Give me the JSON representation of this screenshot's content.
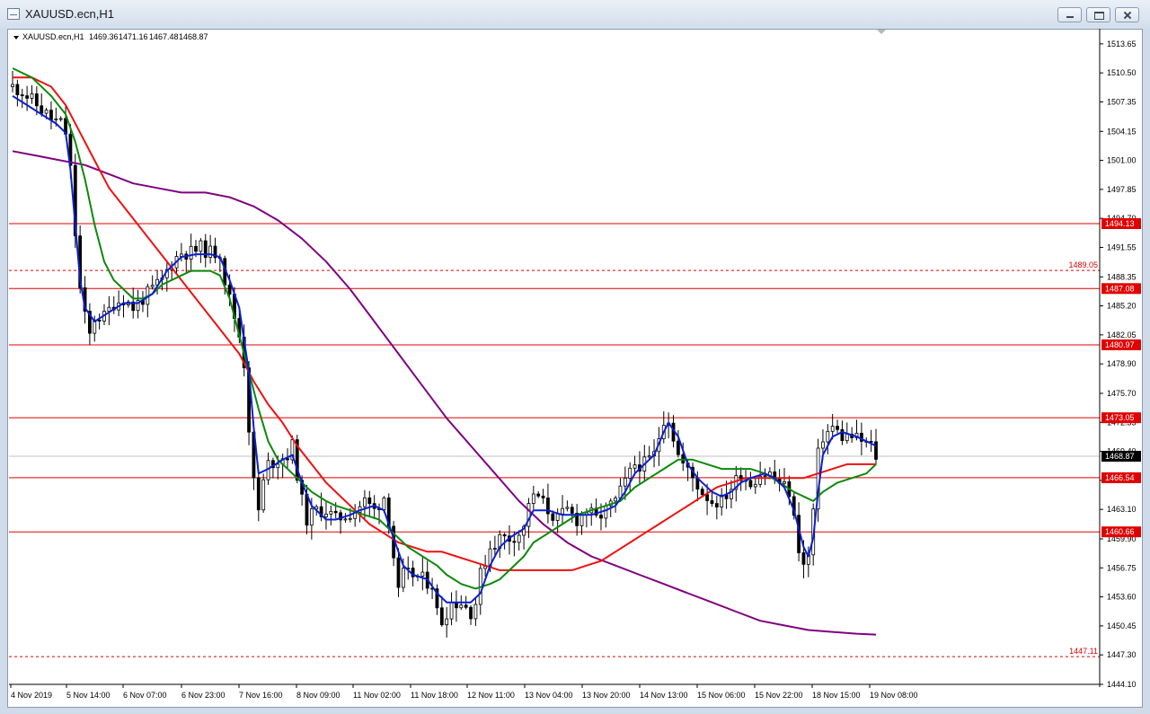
{
  "window": {
    "title": "XAUUSD.ecn,H1"
  },
  "header": {
    "symbol": "XAUUSD.ecn,H1",
    "open": "1469.36",
    "high": "1471.16",
    "low": "1467.48",
    "close": "1468.87"
  },
  "colors": {
    "background": "#ffffff",
    "candle": "#000000",
    "ma_blue": "#0a1fd1",
    "ma_green": "#0a8a0a",
    "ma_red": "#ee1111",
    "ma_purple": "#800080",
    "level_line": "#e00000",
    "price_line": "#c0c0c0"
  },
  "chart_data": {
    "type": "candlestick",
    "symbol": "XAUUSD.ecn",
    "timeframe": "H1",
    "ylim": [
      1444.1,
      1515.0
    ],
    "y_ticks": [
      "1513.65",
      "1510.50",
      "1507.35",
      "1504.15",
      "1501.00",
      "1497.85",
      "1494.70",
      "1491.55",
      "1488.35",
      "1485.20",
      "1482.05",
      "1478.90",
      "1475.70",
      "1472.55",
      "1469.40",
      "1466.25",
      "1463.10",
      "1459.90",
      "1456.75",
      "1453.60",
      "1450.45",
      "1447.30",
      "1444.10"
    ],
    "x_ticks": [
      "4 Nov 2019",
      "5 Nov 14:00",
      "6 Nov 07:00",
      "6 Nov 23:00",
      "7 Nov 16:00",
      "8 Nov 09:00",
      "11 Nov 02:00",
      "11 Nov 18:00",
      "12 Nov 11:00",
      "13 Nov 04:00",
      "13 Nov 20:00",
      "14 Nov 13:00",
      "15 Nov 06:00",
      "15 Nov 22:00",
      "18 Nov 15:00",
      "19 Nov 08:00"
    ],
    "levels": [
      {
        "price": 1494.13,
        "label": "1494.13",
        "style": "solid"
      },
      {
        "price": 1489.05,
        "label": "1489.05",
        "style": "dashed"
      },
      {
        "price": 1487.08,
        "label": "1487.08",
        "style": "solid"
      },
      {
        "price": 1480.97,
        "label": "1480.97",
        "style": "solid"
      },
      {
        "price": 1473.05,
        "label": "1473.05",
        "style": "solid"
      },
      {
        "price": 1466.54,
        "label": "1466.54",
        "style": "solid"
      },
      {
        "price": 1460.66,
        "label": "1460.66",
        "style": "solid"
      },
      {
        "price": 1447.11,
        "label": "1447.11",
        "style": "dashed"
      }
    ],
    "current_price": {
      "price": 1468.87,
      "label": "1468.87"
    },
    "close_path": [
      [
        0,
        1509
      ],
      [
        2,
        1508.5
      ],
      [
        4,
        1507.5
      ],
      [
        6,
        1506.5
      ],
      [
        8,
        1505.5
      ],
      [
        10,
        1505
      ],
      [
        11,
        1504
      ],
      [
        12,
        1500
      ],
      [
        13,
        1493
      ],
      [
        14,
        1487
      ],
      [
        15,
        1484
      ],
      [
        16,
        1482
      ],
      [
        17,
        1484
      ],
      [
        19,
        1484
      ],
      [
        21,
        1485.5
      ],
      [
        23,
        1486
      ],
      [
        25,
        1485
      ],
      [
        27,
        1486
      ],
      [
        29,
        1487
      ],
      [
        31,
        1488
      ],
      [
        33,
        1490
      ],
      [
        35,
        1491
      ],
      [
        37,
        1491
      ],
      [
        39,
        1491.5
      ],
      [
        41,
        1491
      ],
      [
        43,
        1491
      ],
      [
        44,
        1488
      ],
      [
        45,
        1486
      ],
      [
        46,
        1484
      ],
      [
        47,
        1482
      ],
      [
        48,
        1479
      ],
      [
        49,
        1472
      ],
      [
        50,
        1466
      ],
      [
        51,
        1463
      ],
      [
        52,
        1466
      ],
      [
        53,
        1468
      ],
      [
        55,
        1468.5
      ],
      [
        57,
        1469
      ],
      [
        58,
        1470
      ],
      [
        59,
        1467
      ],
      [
        60,
        1464
      ],
      [
        61,
        1462
      ],
      [
        63,
        1463
      ],
      [
        65,
        1463
      ],
      [
        67,
        1462
      ],
      [
        69,
        1462.5
      ],
      [
        71,
        1463
      ],
      [
        73,
        1464
      ],
      [
        75,
        1463
      ],
      [
        77,
        1464.5
      ],
      [
        78,
        1462
      ],
      [
        79,
        1458
      ],
      [
        80,
        1454
      ],
      [
        81,
        1456
      ],
      [
        83,
        1456
      ],
      [
        85,
        1455.5
      ],
      [
        87,
        1455
      ],
      [
        88,
        1452
      ],
      [
        89,
        1451
      ],
      [
        91,
        1453
      ],
      [
        93,
        1453
      ],
      [
        95,
        1452
      ],
      [
        96,
        1453
      ],
      [
        97,
        1456
      ],
      [
        99,
        1459
      ],
      [
        101,
        1460
      ],
      [
        103,
        1460
      ],
      [
        105,
        1460.5
      ],
      [
        106,
        1461
      ],
      [
        107,
        1464
      ],
      [
        109,
        1464.5
      ],
      [
        111,
        1463
      ],
      [
        113,
        1462
      ],
      [
        115,
        1463
      ],
      [
        117,
        1462
      ],
      [
        119,
        1463
      ],
      [
        121,
        1462
      ],
      [
        123,
        1463
      ],
      [
        125,
        1464
      ],
      [
        127,
        1466
      ],
      [
        129,
        1468
      ],
      [
        131,
        1468
      ],
      [
        133,
        1469
      ],
      [
        134,
        1471
      ],
      [
        135,
        1473
      ],
      [
        136,
        1473
      ],
      [
        137,
        1471
      ],
      [
        138,
        1469
      ],
      [
        139,
        1468
      ],
      [
        141,
        1466.5
      ],
      [
        143,
        1465
      ],
      [
        145,
        1464
      ],
      [
        147,
        1464
      ],
      [
        149,
        1465.5
      ],
      [
        151,
        1467
      ],
      [
        153,
        1466
      ],
      [
        155,
        1467
      ],
      [
        157,
        1467
      ],
      [
        159,
        1466
      ],
      [
        161,
        1465
      ],
      [
        162,
        1462
      ],
      [
        163,
        1459
      ],
      [
        164,
        1457
      ],
      [
        165,
        1458
      ],
      [
        166,
        1463
      ],
      [
        167,
        1469
      ],
      [
        168,
        1471
      ],
      [
        170,
        1472
      ],
      [
        172,
        1471
      ],
      [
        174,
        1471
      ],
      [
        176,
        1470.5
      ],
      [
        178,
        1470
      ],
      [
        179,
        1468.87
      ]
    ],
    "ma_blue": [
      [
        0,
        1508
      ],
      [
        3,
        1507
      ],
      [
        6,
        1506
      ],
      [
        9,
        1505
      ],
      [
        11,
        1504
      ],
      [
        12,
        1500
      ],
      [
        13,
        1494
      ],
      [
        14,
        1488
      ],
      [
        15,
        1485
      ],
      [
        17,
        1483.5
      ],
      [
        20,
        1484.5
      ],
      [
        23,
        1485.5
      ],
      [
        26,
        1485.5
      ],
      [
        29,
        1486.5
      ],
      [
        32,
        1489
      ],
      [
        35,
        1490.5
      ],
      [
        38,
        1490.8
      ],
      [
        41,
        1490.8
      ],
      [
        43,
        1490.5
      ],
      [
        45,
        1488
      ],
      [
        47,
        1485
      ],
      [
        49,
        1478
      ],
      [
        50,
        1472
      ],
      [
        51,
        1467
      ],
      [
        53,
        1467.5
      ],
      [
        56,
        1468.5
      ],
      [
        58,
        1469
      ],
      [
        60,
        1466
      ],
      [
        62,
        1463.5
      ],
      [
        65,
        1462
      ],
      [
        67,
        1462
      ],
      [
        70,
        1462.5
      ],
      [
        72,
        1463
      ],
      [
        75,
        1463.5
      ],
      [
        77,
        1463
      ],
      [
        79,
        1460
      ],
      [
        81,
        1457
      ],
      [
        83,
        1456
      ],
      [
        86,
        1455.5
      ],
      [
        88,
        1454
      ],
      [
        90,
        1453
      ],
      [
        92,
        1453
      ],
      [
        95,
        1453
      ],
      [
        97,
        1454
      ],
      [
        99,
        1457
      ],
      [
        101,
        1459
      ],
      [
        103,
        1460
      ],
      [
        106,
        1461
      ],
      [
        108,
        1463
      ],
      [
        111,
        1463
      ],
      [
        114,
        1462.5
      ],
      [
        117,
        1462.5
      ],
      [
        120,
        1462.5
      ],
      [
        123,
        1463
      ],
      [
        125,
        1463.5
      ],
      [
        127,
        1465
      ],
      [
        129,
        1467
      ],
      [
        131,
        1468
      ],
      [
        133,
        1469
      ],
      [
        135,
        1471.5
      ],
      [
        136,
        1472.5
      ],
      [
        138,
        1471
      ],
      [
        140,
        1468
      ],
      [
        142,
        1466.5
      ],
      [
        145,
        1465
      ],
      [
        147,
        1464.5
      ],
      [
        149,
        1465
      ],
      [
        151,
        1466
      ],
      [
        153,
        1466.5
      ],
      [
        156,
        1467
      ],
      [
        158,
        1466.5
      ],
      [
        160,
        1465.5
      ],
      [
        162,
        1463
      ],
      [
        164,
        1459
      ],
      [
        165,
        1458
      ],
      [
        166,
        1460
      ],
      [
        167,
        1465
      ],
      [
        168,
        1469
      ],
      [
        170,
        1471
      ],
      [
        172,
        1471.5
      ],
      [
        175,
        1471
      ],
      [
        177,
        1470.5
      ],
      [
        179,
        1470
      ]
    ],
    "ma_green": [
      [
        0,
        1511
      ],
      [
        4,
        1510
      ],
      [
        8,
        1508
      ],
      [
        11,
        1506
      ],
      [
        13,
        1503
      ],
      [
        15,
        1499
      ],
      [
        17,
        1494
      ],
      [
        19,
        1490
      ],
      [
        21,
        1488
      ],
      [
        23,
        1487
      ],
      [
        25,
        1486
      ],
      [
        27,
        1486
      ],
      [
        29,
        1486.5
      ],
      [
        31,
        1487.5
      ],
      [
        33,
        1488
      ],
      [
        35,
        1488.5
      ],
      [
        37,
        1489
      ],
      [
        39,
        1489
      ],
      [
        41,
        1489
      ],
      [
        43,
        1488.5
      ],
      [
        45,
        1486
      ],
      [
        47,
        1482
      ],
      [
        49,
        1478
      ],
      [
        51,
        1474
      ],
      [
        53,
        1470.5
      ],
      [
        55,
        1468.5
      ],
      [
        58,
        1467
      ],
      [
        60,
        1466
      ],
      [
        62,
        1465
      ],
      [
        65,
        1464
      ],
      [
        67,
        1463.5
      ],
      [
        70,
        1463
      ],
      [
        73,
        1462.5
      ],
      [
        76,
        1462
      ],
      [
        78,
        1461
      ],
      [
        80,
        1460
      ],
      [
        82,
        1459
      ],
      [
        85,
        1458
      ],
      [
        88,
        1457
      ],
      [
        90,
        1456
      ],
      [
        93,
        1455
      ],
      [
        96,
        1454.5
      ],
      [
        99,
        1455
      ],
      [
        101,
        1455.5
      ],
      [
        103,
        1456.5
      ],
      [
        106,
        1458
      ],
      [
        108,
        1459.5
      ],
      [
        111,
        1460.5
      ],
      [
        114,
        1461.5
      ],
      [
        117,
        1462.5
      ],
      [
        120,
        1463
      ],
      [
        123,
        1463.5
      ],
      [
        126,
        1464
      ],
      [
        129,
        1465.5
      ],
      [
        132,
        1466.5
      ],
      [
        135,
        1467.5
      ],
      [
        138,
        1468.5
      ],
      [
        141,
        1468.5
      ],
      [
        144,
        1468
      ],
      [
        147,
        1467.5
      ],
      [
        150,
        1467.5
      ],
      [
        153,
        1467.5
      ],
      [
        156,
        1467
      ],
      [
        159,
        1466
      ],
      [
        162,
        1465
      ],
      [
        164,
        1464.5
      ],
      [
        166,
        1464
      ],
      [
        168,
        1465
      ],
      [
        171,
        1466
      ],
      [
        174,
        1466.5
      ],
      [
        177,
        1467
      ],
      [
        179,
        1468
      ]
    ],
    "ma_red": [
      [
        0,
        1510
      ],
      [
        4,
        1510
      ],
      [
        8,
        1509
      ],
      [
        11,
        1507
      ],
      [
        14,
        1504
      ],
      [
        17,
        1501
      ],
      [
        20,
        1498
      ],
      [
        23,
        1496
      ],
      [
        26,
        1494
      ],
      [
        29,
        1492
      ],
      [
        32,
        1490
      ],
      [
        35,
        1488
      ],
      [
        38,
        1486
      ],
      [
        41,
        1484
      ],
      [
        44,
        1482
      ],
      [
        47,
        1480
      ],
      [
        50,
        1477
      ],
      [
        53,
        1474.5
      ],
      [
        56,
        1472.5
      ],
      [
        59,
        1470
      ],
      [
        62,
        1468
      ],
      [
        65,
        1466
      ],
      [
        68,
        1464.5
      ],
      [
        71,
        1463
      ],
      [
        74,
        1461.5
      ],
      [
        77,
        1460.5
      ],
      [
        80,
        1459.5
      ],
      [
        83,
        1459
      ],
      [
        86,
        1458.5
      ],
      [
        89,
        1458.5
      ],
      [
        92,
        1458
      ],
      [
        95,
        1457.5
      ],
      [
        98,
        1457
      ],
      [
        101,
        1456.5
      ],
      [
        104,
        1456.5
      ],
      [
        107,
        1456.5
      ],
      [
        110,
        1456.5
      ],
      [
        113,
        1456.5
      ],
      [
        116,
        1456.5
      ],
      [
        119,
        1457
      ],
      [
        122,
        1457.5
      ],
      [
        125,
        1458.5
      ],
      [
        128,
        1459.5
      ],
      [
        131,
        1460.5
      ],
      [
        134,
        1461.5
      ],
      [
        137,
        1462.5
      ],
      [
        140,
        1463.5
      ],
      [
        143,
        1464.5
      ],
      [
        146,
        1465.5
      ],
      [
        149,
        1466
      ],
      [
        152,
        1466.5
      ],
      [
        155,
        1466.5
      ],
      [
        158,
        1466.5
      ],
      [
        161,
        1466.5
      ],
      [
        164,
        1466.5
      ],
      [
        167,
        1467
      ],
      [
        170,
        1467.5
      ],
      [
        173,
        1468
      ],
      [
        176,
        1468
      ],
      [
        178,
        1468
      ],
      [
        179,
        1468
      ]
    ],
    "ma_purple": [
      [
        0,
        1502
      ],
      [
        5,
        1501.5
      ],
      [
        10,
        1501
      ],
      [
        15,
        1500.5
      ],
      [
        20,
        1499.5
      ],
      [
        25,
        1498.5
      ],
      [
        30,
        1498
      ],
      [
        35,
        1497.5
      ],
      [
        40,
        1497.5
      ],
      [
        45,
        1497
      ],
      [
        50,
        1496
      ],
      [
        55,
        1494.5
      ],
      [
        60,
        1492.5
      ],
      [
        65,
        1490
      ],
      [
        70,
        1487
      ],
      [
        75,
        1483.5
      ],
      [
        80,
        1480
      ],
      [
        85,
        1476.5
      ],
      [
        90,
        1473
      ],
      [
        95,
        1470
      ],
      [
        100,
        1467
      ],
      [
        105,
        1464
      ],
      [
        110,
        1461.5
      ],
      [
        115,
        1459.5
      ],
      [
        120,
        1458
      ],
      [
        125,
        1457
      ],
      [
        130,
        1456
      ],
      [
        135,
        1455
      ],
      [
        140,
        1454
      ],
      [
        145,
        1453
      ],
      [
        150,
        1452
      ],
      [
        155,
        1451
      ],
      [
        160,
        1450.5
      ],
      [
        165,
        1450
      ],
      [
        170,
        1449.8
      ],
      [
        175,
        1449.6
      ],
      [
        179,
        1449.5
      ]
    ]
  }
}
